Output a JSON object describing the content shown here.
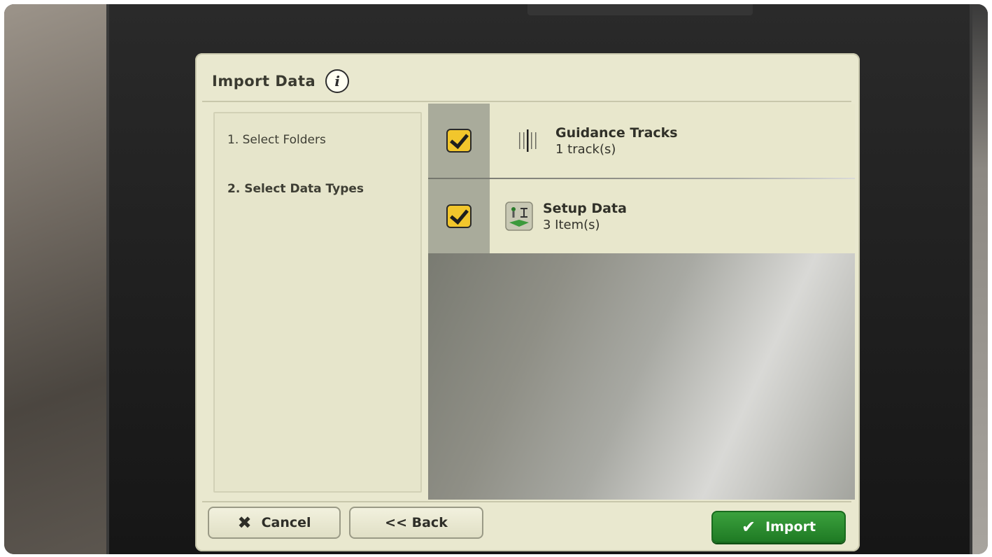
{
  "screen": {
    "title": "Import Data",
    "info_icon": "info-icon"
  },
  "steps": [
    {
      "label": "1. Select Folders",
      "active": false
    },
    {
      "label": "2. Select Data Types",
      "active": true
    }
  ],
  "data_types": [
    {
      "title": "Guidance Tracks",
      "subtitle": "1 track(s)",
      "checked": true,
      "icon": "guidance-tracks-icon"
    },
    {
      "title": "Setup Data",
      "subtitle": "3 Item(s)",
      "checked": true,
      "icon": "setup-data-icon"
    }
  ],
  "buttons": {
    "cancel": "Cancel",
    "back": "<< Back",
    "import": "Import"
  },
  "colors": {
    "screen_background": "#e9e8cf",
    "checkbox": "#f2c62c",
    "import_button": "#2a8f2e"
  }
}
